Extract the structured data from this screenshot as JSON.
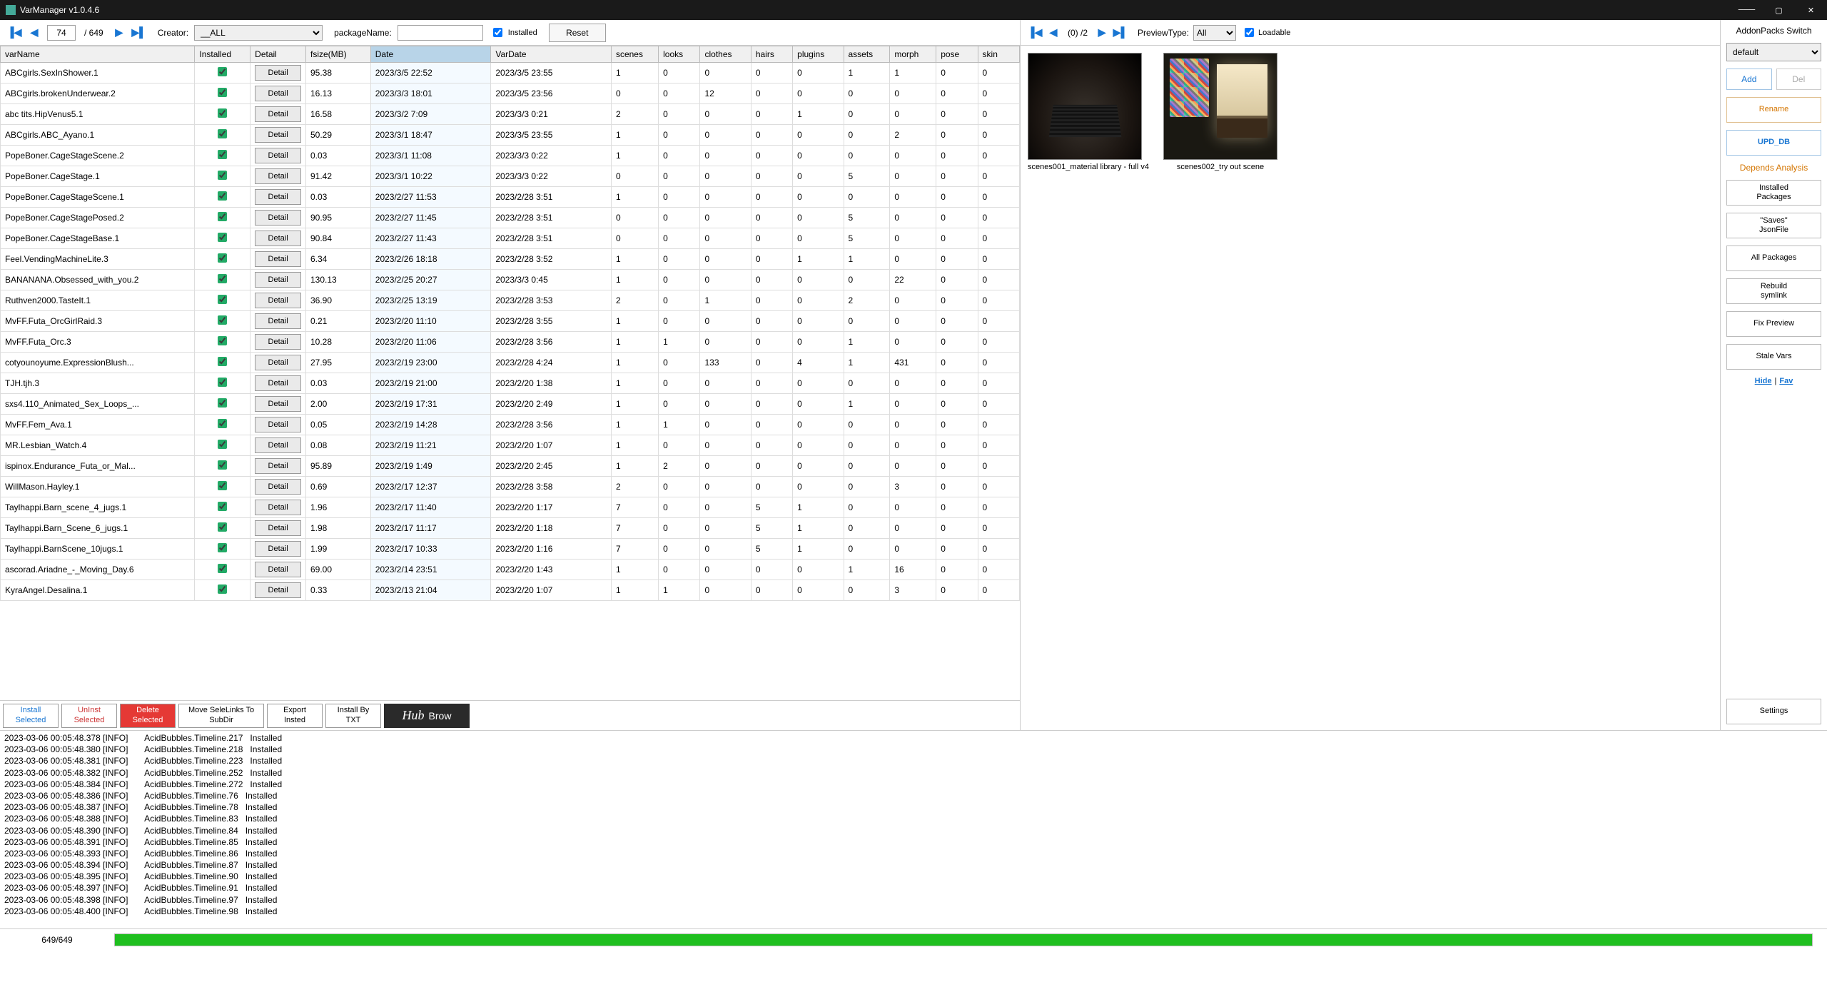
{
  "title": "VarManager  v1.0.4.6",
  "toolbar": {
    "page_current": "74",
    "page_total": "/ 649",
    "creator_label": "Creator:",
    "creator_value": "__ALL",
    "package_label": "packageName:",
    "package_value": "",
    "installed_label": "Installed",
    "installed_checked": true,
    "reset": "Reset"
  },
  "columns": [
    "varName",
    "Installed",
    "Detail",
    "fsize(MB)",
    "Date",
    "VarDate",
    "scenes",
    "looks",
    "clothes",
    "hairs",
    "plugins",
    "assets",
    "morph",
    "pose",
    "skin"
  ],
  "sorted_col": 4,
  "detail_label": "Detail",
  "rows": [
    {
      "name": "ABCgirls.SexInShower.1",
      "inst": true,
      "fsize": "95.38",
      "date": "2023/3/5 22:52",
      "vdate": "2023/3/5 23:55",
      "sc": "1",
      "lk": "0",
      "cl": "0",
      "hr": "0",
      "pl": "0",
      "as": "1",
      "mo": "1",
      "po": "0",
      "sk": "0"
    },
    {
      "name": "ABCgirls.brokenUnderwear.2",
      "inst": true,
      "fsize": "16.13",
      "date": "2023/3/3 18:01",
      "vdate": "2023/3/5 23:56",
      "sc": "0",
      "lk": "0",
      "cl": "12",
      "hr": "0",
      "pl": "0",
      "as": "0",
      "mo": "0",
      "po": "0",
      "sk": "0"
    },
    {
      "name": "abc tits.HipVenus5.1",
      "inst": true,
      "fsize": "16.58",
      "date": "2023/3/2 7:09",
      "vdate": "2023/3/3 0:21",
      "sc": "2",
      "lk": "0",
      "cl": "0",
      "hr": "0",
      "pl": "1",
      "as": "0",
      "mo": "0",
      "po": "0",
      "sk": "0"
    },
    {
      "name": "ABCgirls.ABC_Ayano.1",
      "inst": true,
      "fsize": "50.29",
      "date": "2023/3/1 18:47",
      "vdate": "2023/3/5 23:55",
      "sc": "1",
      "lk": "0",
      "cl": "0",
      "hr": "0",
      "pl": "0",
      "as": "0",
      "mo": "2",
      "po": "0",
      "sk": "0"
    },
    {
      "name": "PopeBoner.CageStageScene.2",
      "inst": true,
      "fsize": "0.03",
      "date": "2023/3/1 11:08",
      "vdate": "2023/3/3 0:22",
      "sc": "1",
      "lk": "0",
      "cl": "0",
      "hr": "0",
      "pl": "0",
      "as": "0",
      "mo": "0",
      "po": "0",
      "sk": "0"
    },
    {
      "name": "PopeBoner.CageStage.1",
      "inst": true,
      "fsize": "91.42",
      "date": "2023/3/1 10:22",
      "vdate": "2023/3/3 0:22",
      "sc": "0",
      "lk": "0",
      "cl": "0",
      "hr": "0",
      "pl": "0",
      "as": "5",
      "mo": "0",
      "po": "0",
      "sk": "0"
    },
    {
      "name": "PopeBoner.CageStageScene.1",
      "inst": true,
      "fsize": "0.03",
      "date": "2023/2/27 11:53",
      "vdate": "2023/2/28 3:51",
      "sc": "1",
      "lk": "0",
      "cl": "0",
      "hr": "0",
      "pl": "0",
      "as": "0",
      "mo": "0",
      "po": "0",
      "sk": "0"
    },
    {
      "name": "PopeBoner.CageStagePosed.2",
      "inst": true,
      "fsize": "90.95",
      "date": "2023/2/27 11:45",
      "vdate": "2023/2/28 3:51",
      "sc": "0",
      "lk": "0",
      "cl": "0",
      "hr": "0",
      "pl": "0",
      "as": "5",
      "mo": "0",
      "po": "0",
      "sk": "0"
    },
    {
      "name": "PopeBoner.CageStageBase.1",
      "inst": true,
      "fsize": "90.84",
      "date": "2023/2/27 11:43",
      "vdate": "2023/2/28 3:51",
      "sc": "0",
      "lk": "0",
      "cl": "0",
      "hr": "0",
      "pl": "0",
      "as": "5",
      "mo": "0",
      "po": "0",
      "sk": "0"
    },
    {
      "name": "Feel.VendingMachineLite.3",
      "inst": true,
      "fsize": "6.34",
      "date": "2023/2/26 18:18",
      "vdate": "2023/2/28 3:52",
      "sc": "1",
      "lk": "0",
      "cl": "0",
      "hr": "0",
      "pl": "1",
      "as": "1",
      "mo": "0",
      "po": "0",
      "sk": "0"
    },
    {
      "name": "BANANANA.Obsessed_with_you.2",
      "inst": true,
      "fsize": "130.13",
      "date": "2023/2/25 20:27",
      "vdate": "2023/3/3 0:45",
      "sc": "1",
      "lk": "0",
      "cl": "0",
      "hr": "0",
      "pl": "0",
      "as": "0",
      "mo": "22",
      "po": "0",
      "sk": "0"
    },
    {
      "name": "Ruthven2000.TasteIt.1",
      "inst": true,
      "fsize": "36.90",
      "date": "2023/2/25 13:19",
      "vdate": "2023/2/28 3:53",
      "sc": "2",
      "lk": "0",
      "cl": "1",
      "hr": "0",
      "pl": "0",
      "as": "2",
      "mo": "0",
      "po": "0",
      "sk": "0"
    },
    {
      "name": "MvFF.Futa_OrcGirlRaid.3",
      "inst": true,
      "fsize": "0.21",
      "date": "2023/2/20 11:10",
      "vdate": "2023/2/28 3:55",
      "sc": "1",
      "lk": "0",
      "cl": "0",
      "hr": "0",
      "pl": "0",
      "as": "0",
      "mo": "0",
      "po": "0",
      "sk": "0"
    },
    {
      "name": "MvFF.Futa_Orc.3",
      "inst": true,
      "fsize": "10.28",
      "date": "2023/2/20 11:06",
      "vdate": "2023/2/28 3:56",
      "sc": "1",
      "lk": "1",
      "cl": "0",
      "hr": "0",
      "pl": "0",
      "as": "1",
      "mo": "0",
      "po": "0",
      "sk": "0"
    },
    {
      "name": "cotyounoyume.ExpressionBlush...",
      "inst": true,
      "fsize": "27.95",
      "date": "2023/2/19 23:00",
      "vdate": "2023/2/28 4:24",
      "sc": "1",
      "lk": "0",
      "cl": "133",
      "hr": "0",
      "pl": "4",
      "as": "1",
      "mo": "431",
      "po": "0",
      "sk": "0"
    },
    {
      "name": "TJH.tjh.3",
      "inst": true,
      "fsize": "0.03",
      "date": "2023/2/19 21:00",
      "vdate": "2023/2/20 1:38",
      "sc": "1",
      "lk": "0",
      "cl": "0",
      "hr": "0",
      "pl": "0",
      "as": "0",
      "mo": "0",
      "po": "0",
      "sk": "0"
    },
    {
      "name": "sxs4.110_Animated_Sex_Loops_...",
      "inst": true,
      "fsize": "2.00",
      "date": "2023/2/19 17:31",
      "vdate": "2023/2/20 2:49",
      "sc": "1",
      "lk": "0",
      "cl": "0",
      "hr": "0",
      "pl": "0",
      "as": "1",
      "mo": "0",
      "po": "0",
      "sk": "0"
    },
    {
      "name": "MvFF.Fem_Ava.1",
      "inst": true,
      "fsize": "0.05",
      "date": "2023/2/19 14:28",
      "vdate": "2023/2/28 3:56",
      "sc": "1",
      "lk": "1",
      "cl": "0",
      "hr": "0",
      "pl": "0",
      "as": "0",
      "mo": "0",
      "po": "0",
      "sk": "0"
    },
    {
      "name": "MR.Lesbian_Watch.4",
      "inst": true,
      "fsize": "0.08",
      "date": "2023/2/19 11:21",
      "vdate": "2023/2/20 1:07",
      "sc": "1",
      "lk": "0",
      "cl": "0",
      "hr": "0",
      "pl": "0",
      "as": "0",
      "mo": "0",
      "po": "0",
      "sk": "0"
    },
    {
      "name": "ispinox.Endurance_Futa_or_Mal...",
      "inst": true,
      "fsize": "95.89",
      "date": "2023/2/19 1:49",
      "vdate": "2023/2/20 2:45",
      "sc": "1",
      "lk": "2",
      "cl": "0",
      "hr": "0",
      "pl": "0",
      "as": "0",
      "mo": "0",
      "po": "0",
      "sk": "0"
    },
    {
      "name": "WillMason.Hayley.1",
      "inst": true,
      "fsize": "0.69",
      "date": "2023/2/17 12:37",
      "vdate": "2023/2/28 3:58",
      "sc": "2",
      "lk": "0",
      "cl": "0",
      "hr": "0",
      "pl": "0",
      "as": "0",
      "mo": "3",
      "po": "0",
      "sk": "0"
    },
    {
      "name": "Taylhappi.Barn_scene_4_jugs.1",
      "inst": true,
      "fsize": "1.96",
      "date": "2023/2/17 11:40",
      "vdate": "2023/2/20 1:17",
      "sc": "7",
      "lk": "0",
      "cl": "0",
      "hr": "5",
      "pl": "1",
      "as": "0",
      "mo": "0",
      "po": "0",
      "sk": "0"
    },
    {
      "name": "Taylhappi.Barn_Scene_6_jugs.1",
      "inst": true,
      "fsize": "1.98",
      "date": "2023/2/17 11:17",
      "vdate": "2023/2/20 1:18",
      "sc": "7",
      "lk": "0",
      "cl": "0",
      "hr": "5",
      "pl": "1",
      "as": "0",
      "mo": "0",
      "po": "0",
      "sk": "0"
    },
    {
      "name": "Taylhappi.BarnScene_10jugs.1",
      "inst": true,
      "fsize": "1.99",
      "date": "2023/2/17 10:33",
      "vdate": "2023/2/20 1:16",
      "sc": "7",
      "lk": "0",
      "cl": "0",
      "hr": "5",
      "pl": "1",
      "as": "0",
      "mo": "0",
      "po": "0",
      "sk": "0"
    },
    {
      "name": "ascorad.Ariadne_-_Moving_Day.6",
      "inst": true,
      "fsize": "69.00",
      "date": "2023/2/14 23:51",
      "vdate": "2023/2/20 1:43",
      "sc": "1",
      "lk": "0",
      "cl": "0",
      "hr": "0",
      "pl": "0",
      "as": "1",
      "mo": "16",
      "po": "0",
      "sk": "0"
    },
    {
      "name": "KyraAngel.Desalina.1",
      "inst": true,
      "fsize": "0.33",
      "date": "2023/2/13 21:04",
      "vdate": "2023/2/20 1:07",
      "sc": "1",
      "lk": "1",
      "cl": "0",
      "hr": "0",
      "pl": "0",
      "as": "0",
      "mo": "3",
      "po": "0",
      "sk": "0"
    }
  ],
  "actions": {
    "install": "Install\nSelected",
    "uninst": "UnInst\nSelected",
    "delete": "Delete\nSelected",
    "move": "Move SeleLinks To\nSubDir",
    "export": "Export\nInsted",
    "txt": "Install By\nTXT",
    "hub": "Brow"
  },
  "preview": {
    "page_text": "(0)   /2",
    "type_label": "PreviewType:",
    "type_value": "All",
    "loadable_label": "Loadable",
    "loadable_checked": true,
    "thumbs": [
      {
        "label": "scenes001_material library - full v4"
      },
      {
        "label": "scenes002_try out scene"
      }
    ]
  },
  "addon": {
    "title": "AddonPacks Switch",
    "select": "default",
    "add": "Add",
    "del": "Del",
    "rename": "Rename",
    "upd": "UPD_DB",
    "depends": "Depends Analysis",
    "inst_pkg": "Installed\nPackages",
    "saves": "\"Saves\"\nJsonFile",
    "all_pkg": "All Packages",
    "rebuild": "Rebuild\nsymlink",
    "fix": "Fix Preview",
    "stale": "Stale Vars",
    "hide": "Hide",
    "fav": "Fav",
    "settings": "Settings"
  },
  "log_lines": [
    "2023-03-06 00:05:48.378 [INFO]       AcidBubbles.Timeline.217   Installed",
    "2023-03-06 00:05:48.380 [INFO]       AcidBubbles.Timeline.218   Installed",
    "2023-03-06 00:05:48.381 [INFO]       AcidBubbles.Timeline.223   Installed",
    "2023-03-06 00:05:48.382 [INFO]       AcidBubbles.Timeline.252   Installed",
    "2023-03-06 00:05:48.384 [INFO]       AcidBubbles.Timeline.272   Installed",
    "2023-03-06 00:05:48.386 [INFO]       AcidBubbles.Timeline.76   Installed",
    "2023-03-06 00:05:48.387 [INFO]       AcidBubbles.Timeline.78   Installed",
    "2023-03-06 00:05:48.388 [INFO]       AcidBubbles.Timeline.83   Installed",
    "2023-03-06 00:05:48.390 [INFO]       AcidBubbles.Timeline.84   Installed",
    "2023-03-06 00:05:48.391 [INFO]       AcidBubbles.Timeline.85   Installed",
    "2023-03-06 00:05:48.393 [INFO]       AcidBubbles.Timeline.86   Installed",
    "2023-03-06 00:05:48.394 [INFO]       AcidBubbles.Timeline.87   Installed",
    "2023-03-06 00:05:48.395 [INFO]       AcidBubbles.Timeline.90   Installed",
    "2023-03-06 00:05:48.397 [INFO]       AcidBubbles.Timeline.91   Installed",
    "2023-03-06 00:05:48.398 [INFO]       AcidBubbles.Timeline.97   Installed",
    "2023-03-06 00:05:48.400 [INFO]       AcidBubbles.Timeline.98   Installed"
  ],
  "status": {
    "text": "649/649",
    "progress": 100
  }
}
